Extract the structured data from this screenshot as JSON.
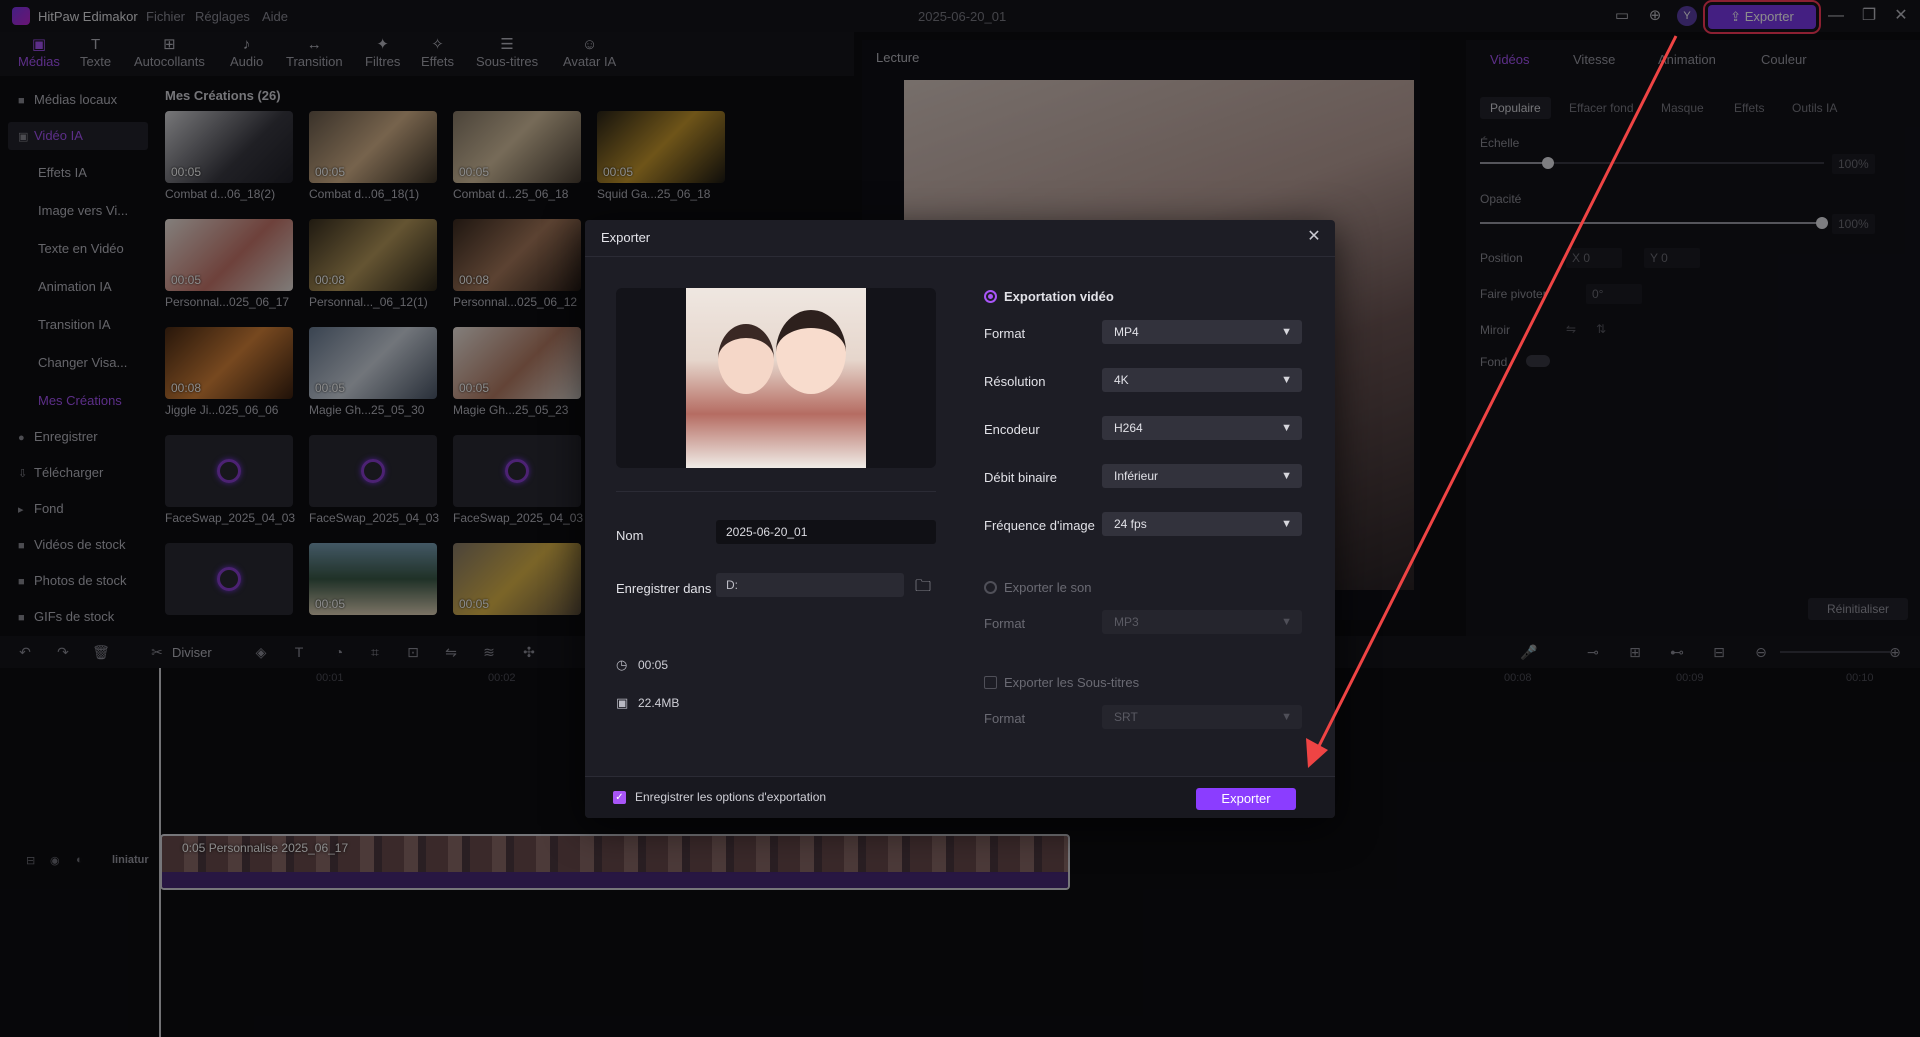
{
  "app": {
    "name": "HitPaw Edimakor",
    "menus": [
      "Fichier",
      "Réglages",
      "Aide"
    ],
    "project_date": "2025-06-20_01",
    "export_button": "Exporter",
    "avatar_letter": "Y"
  },
  "tool_tabs": [
    {
      "label": "Médias",
      "icon": "media-icon"
    },
    {
      "label": "Texte",
      "icon": "text-icon"
    },
    {
      "label": "Autocollants",
      "icon": "sticker-icon"
    },
    {
      "label": "Audio",
      "icon": "audio-icon"
    },
    {
      "label": "Transition",
      "icon": "transition-icon"
    },
    {
      "label": "Filtres",
      "icon": "filter-icon"
    },
    {
      "label": "Effets",
      "icon": "effects-icon"
    },
    {
      "label": "Sous-titres",
      "icon": "subtitles-icon"
    },
    {
      "label": "Avatar IA",
      "icon": "avatar-icon"
    }
  ],
  "sidebar": {
    "items": [
      {
        "label": "Médias locaux",
        "type": "main"
      },
      {
        "label": "Vidéo IA",
        "type": "main"
      },
      {
        "label": "Effets IA",
        "type": "sub"
      },
      {
        "label": "Image vers Vi...",
        "type": "sub"
      },
      {
        "label": "Texte en Vidéo",
        "type": "sub"
      },
      {
        "label": "Animation IA",
        "type": "sub"
      },
      {
        "label": "Transition IA",
        "type": "sub"
      },
      {
        "label": "Changer Visa...",
        "type": "sub"
      },
      {
        "label": "Mes Créations",
        "type": "sub"
      },
      {
        "label": "Enregistrer",
        "type": "main"
      },
      {
        "label": "Télécharger",
        "type": "main"
      },
      {
        "label": "Fond",
        "type": "main"
      },
      {
        "label": "Vidéos de stock",
        "type": "main"
      },
      {
        "label": "Photos de stock",
        "type": "main"
      },
      {
        "label": "GIFs de stock",
        "type": "main"
      }
    ]
  },
  "media": {
    "title": "Mes Créations (26)",
    "items": [
      {
        "label": "Combat d...06_18(2)",
        "duration": "00:05"
      },
      {
        "label": "Combat d...06_18(1)",
        "duration": "00:05"
      },
      {
        "label": "Combat d...25_06_18",
        "duration": "00:05"
      },
      {
        "label": "Squid Ga...25_06_18",
        "duration": "00:05"
      },
      {
        "label": "Personnal...025_06_17",
        "duration": "00:05"
      },
      {
        "label": "Personnal..._06_12(1)",
        "duration": "00:08"
      },
      {
        "label": "Personnal...025_06_12",
        "duration": "00:08"
      },
      {
        "label": "Jiggle Ji...025_06_06",
        "duration": "00:08"
      },
      {
        "label": "Magie Gh...25_05_30",
        "duration": "00:05"
      },
      {
        "label": "Magie Gh...25_05_23",
        "duration": "00:05"
      },
      {
        "label": "FaceSwap_2025_04_03",
        "duration": ""
      },
      {
        "label": "FaceSwap_2025_04_03",
        "duration": ""
      },
      {
        "label": "FaceSwap_2025_04_03",
        "duration": ""
      },
      {
        "label": "",
        "duration": ""
      },
      {
        "label": "",
        "duration": "00:05"
      },
      {
        "label": "",
        "duration": "00:05"
      }
    ]
  },
  "player": {
    "title": "Lecture"
  },
  "right_panel": {
    "tabs": [
      "Vidéos",
      "Vitesse",
      "Animation",
      "Couleur"
    ],
    "subtabs": [
      "Populaire",
      "Effacer fond",
      "Masque",
      "Effets",
      "Outils IA"
    ],
    "scale_label": "Échelle",
    "scale_value": "100%",
    "opacity_label": "Opacité",
    "opacity_value": "100%",
    "position_label": "Position",
    "pos_x_label": "X",
    "pos_x": "0",
    "pos_y_label": "Y",
    "pos_y": "0",
    "rotate_label": "Faire pivoter",
    "rotate_value": "0°",
    "mirror_label": "Miroir",
    "background_label": "Fond",
    "reset_label": "Réinitialiser"
  },
  "timeline": {
    "split_label": "Diviser",
    "clip_label": "0:05 Personnalise 2025_06_17",
    "track_label": "liniatur",
    "ruler": [
      "00:01",
      "00:02",
      "00:08",
      "00:09",
      "00:10"
    ]
  },
  "dialog": {
    "title": "Exporter",
    "name_label": "Nom",
    "name_value": "2025-06-20_01",
    "save_label": "Enregistrer dans",
    "save_value": "D:",
    "duration": "00:05",
    "size": "22.4MB",
    "video_export_label": "Exportation vidéo",
    "fields": [
      {
        "label": "Format",
        "value": "MP4"
      },
      {
        "label": "Résolution",
        "value": "4K"
      },
      {
        "label": "Encodeur",
        "value": "H264"
      },
      {
        "label": "Débit binaire",
        "value": "Inférieur"
      },
      {
        "label": "Fréquence d'image",
        "value": "24  fps"
      }
    ],
    "audio_export_label": "Exporter le son",
    "audio_format_label": "Format",
    "audio_format_value": "MP3",
    "subtitle_export_label": "Exporter les Sous-titres",
    "subtitle_format_label": "Format",
    "subtitle_format_value": "SRT",
    "remember_label": "Enregistrer les options d'exportation",
    "export_button": "Exporter"
  },
  "colors": {
    "accent": "#a855f7",
    "export_button": "#8b3dff",
    "annotation": "#ff3b5c"
  }
}
